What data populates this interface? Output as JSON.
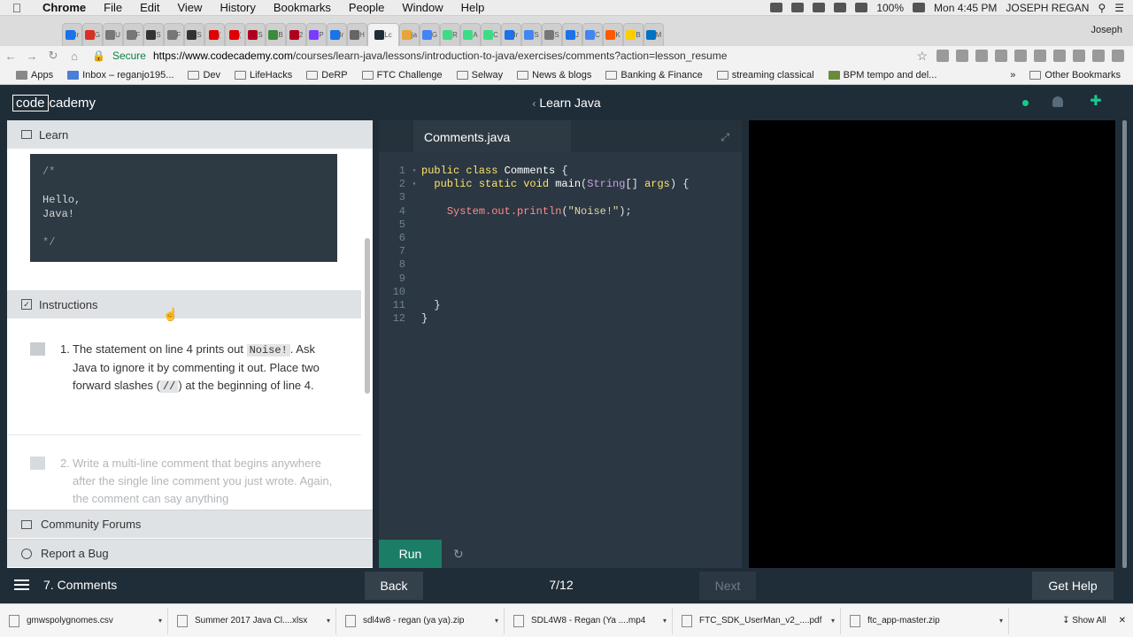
{
  "menubar": {
    "app": "Chrome",
    "items": [
      "File",
      "Edit",
      "View",
      "History",
      "Bookmarks",
      "People",
      "Window",
      "Help"
    ],
    "battery": "100%",
    "clock": "Mon 4:45 PM",
    "user": "JOSEPH REGAN"
  },
  "browser": {
    "profile": "Joseph",
    "tabs": [
      {
        "label": "Ir",
        "color": "#1a73e8"
      },
      {
        "label": "G",
        "color": "#d93025"
      },
      {
        "label": "U",
        "color": "#777"
      },
      {
        "label": "F",
        "color": "#777"
      },
      {
        "label": "S",
        "color": "#333"
      },
      {
        "label": "F",
        "color": "#777"
      },
      {
        "label": "S",
        "color": "#333"
      },
      {
        "label": "(",
        "color": "#e00000"
      },
      {
        "label": "(",
        "color": "#e00000"
      },
      {
        "label": "S",
        "color": "#b00020"
      },
      {
        "label": "B",
        "color": "#3c8a3c"
      },
      {
        "label": "2",
        "color": "#b00020"
      },
      {
        "label": "P",
        "color": "#7a3bff"
      },
      {
        "label": "Ir",
        "color": "#1a73e8"
      },
      {
        "label": "H",
        "color": "#666"
      },
      {
        "label": "Lc",
        "color": "#1f2d38"
      },
      {
        "label": "ja",
        "color": "#e8a33b"
      },
      {
        "label": "G",
        "color": "#4285f4"
      },
      {
        "label": "R",
        "color": "#3ddc84"
      },
      {
        "label": "A",
        "color": "#3ddc84"
      },
      {
        "label": "C",
        "color": "#3ddc84"
      },
      {
        "label": "Ir",
        "color": "#1a73e8"
      },
      {
        "label": "S",
        "color": "#4285f4"
      },
      {
        "label": "S",
        "color": "#777"
      },
      {
        "label": "J",
        "color": "#1a73e8"
      },
      {
        "label": "C",
        "color": "#4285f4"
      },
      {
        "label": "K",
        "color": "#ff5a00"
      },
      {
        "label": "B",
        "color": "#ffcc00"
      },
      {
        "label": "M",
        "color": "#0072c6"
      }
    ],
    "address": {
      "secure_label": "Secure",
      "url_host": "https://www.codecademy.com",
      "url_path": "/courses/learn-java/lessons/introduction-to-java/exercises/comments?action=lesson_resume"
    },
    "bookmarks": [
      {
        "label": "Apps",
        "icon": "apps-icon"
      },
      {
        "label": "Inbox – reganjo195...",
        "icon": "mail-icon"
      },
      {
        "label": "Dev",
        "icon": "folder-icon"
      },
      {
        "label": "LifeHacks",
        "icon": "folder-icon"
      },
      {
        "label": "DeRP",
        "icon": "folder-icon"
      },
      {
        "label": "FTC Challenge",
        "icon": "folder-icon"
      },
      {
        "label": "Selway",
        "icon": "folder-icon"
      },
      {
        "label": "News & blogs",
        "icon": "folder-icon"
      },
      {
        "label": "Banking & Finance",
        "icon": "folder-icon"
      },
      {
        "label": "streaming classical",
        "icon": "folder-icon"
      },
      {
        "label": "BPM tempo and del...",
        "icon": "bird-icon"
      }
    ],
    "bookmarks_more": "»",
    "other_bookmarks": "Other Bookmarks"
  },
  "header": {
    "logo_boxed": "code",
    "logo_rest": "cademy",
    "course_title": "Learn Java",
    "status_color": "#16c98d"
  },
  "learn": {
    "heading": "Learn",
    "code_lines": [
      "/*",
      "",
      "Hello,",
      "Java!",
      "",
      "*/"
    ]
  },
  "instructions": {
    "heading": "Instructions",
    "task1": {
      "number": "1.",
      "before": "The statement on line 4 prints out ",
      "code1": "Noise!",
      "middle": ". Ask Java to ignore it by commenting it out. Place two forward slashes (",
      "code2": "//",
      "after": ") at the beginning of line 4."
    },
    "task2": {
      "number": "2.",
      "text": "Write a multi-line comment that begins anywhere after the single line comment you just wrote. Again, the comment can say anything"
    }
  },
  "footer_links": {
    "forums": "Community Forums",
    "bug": "Report a Bug"
  },
  "editor": {
    "filename": "Comments.java",
    "run_label": "Run",
    "lines": [
      {
        "n": "1",
        "fold": true
      },
      {
        "n": "2",
        "fold": true
      },
      {
        "n": "3"
      },
      {
        "n": "4"
      },
      {
        "n": "5"
      },
      {
        "n": "6"
      },
      {
        "n": "7"
      },
      {
        "n": "8"
      },
      {
        "n": "9"
      },
      {
        "n": "10"
      },
      {
        "n": "11"
      },
      {
        "n": "12"
      }
    ]
  },
  "bottom": {
    "lesson": "7. Comments",
    "back": "Back",
    "progress": "7/12",
    "next": "Next",
    "help": "Get Help"
  },
  "downloads": {
    "items": [
      "gmwspolygnomes.csv",
      "Summer 2017 Java Cl....xlsx",
      "sdl4w8 - regan (ya ya).zip",
      "SDL4W8 - Regan (Ya ....mp4",
      "FTC_SDK_UserMan_v2_....pdf",
      "ftc_app-master.zip"
    ],
    "show_all": "Show All"
  }
}
